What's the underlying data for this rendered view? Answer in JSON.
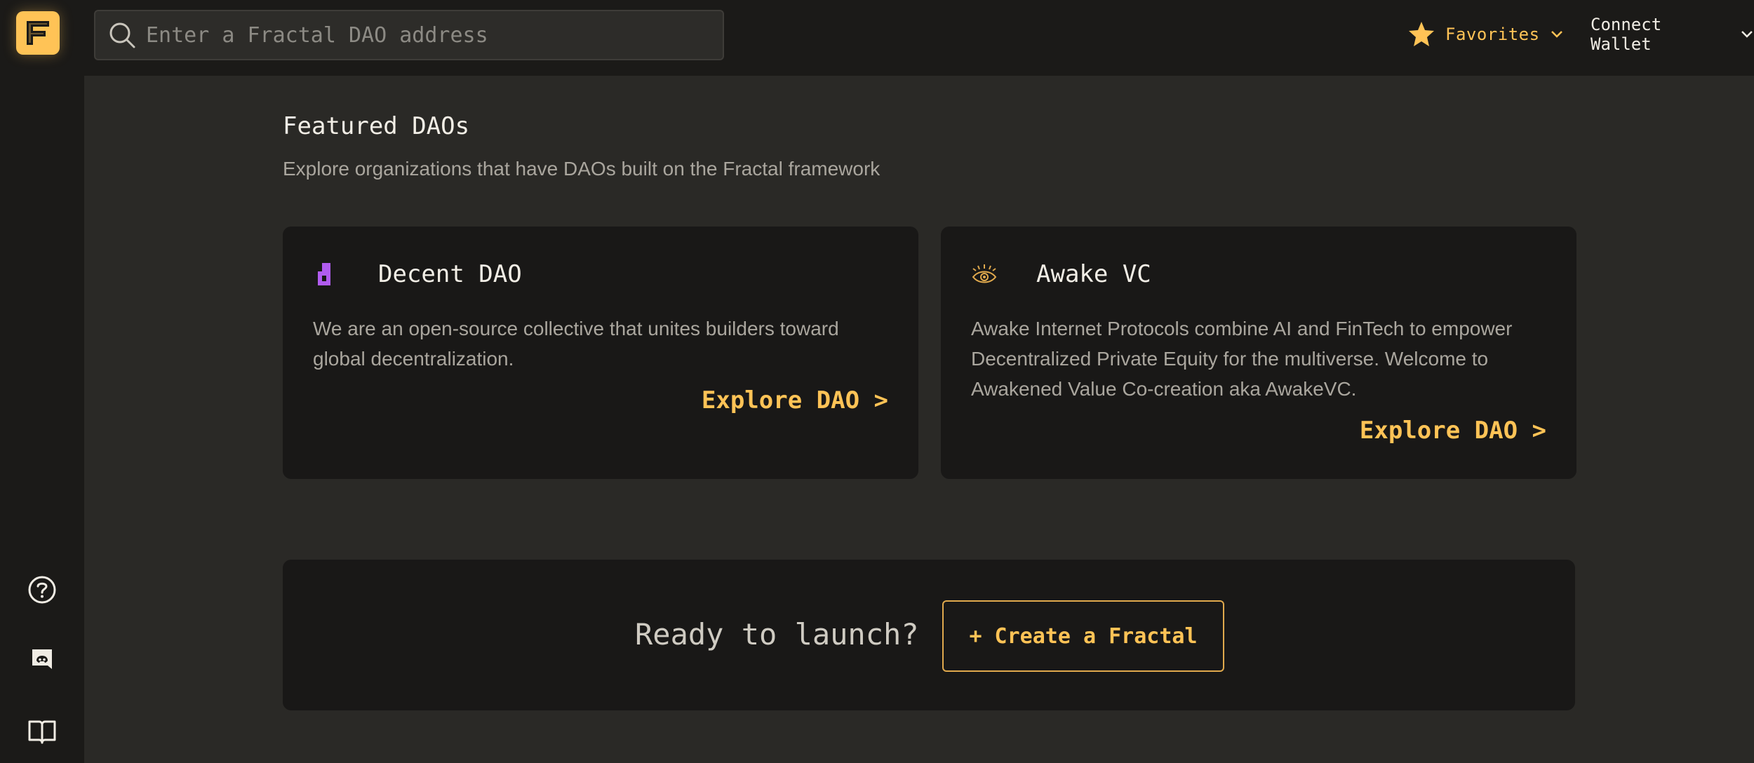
{
  "header": {
    "logo_letter": "F",
    "search_placeholder": "Enter a Fractal DAO address",
    "favorites_label": "Favorites",
    "connect_wallet_label": "Connect Wallet",
    "accent_color": "#ffc356"
  },
  "sidebar": {
    "items": [
      {
        "icon": "help-icon"
      },
      {
        "icon": "discord-icon"
      },
      {
        "icon": "docs-book-icon"
      }
    ]
  },
  "featured": {
    "title": "Featured DAOs",
    "subtitle": "Explore organizations that have DAOs built on the Fractal framework",
    "cards": [
      {
        "icon": "decent-dao-logo-icon",
        "title": "Decent DAO",
        "description": "We are an open-source collective that unites builders toward global decentralization.",
        "link": "Explore DAO >"
      },
      {
        "icon": "awake-eye-icon",
        "title": "Awake VC",
        "description": "Awake Internet Protocols combine AI and FinTech to empower Decentralized Private Equity for the multiverse. Welcome to Awakened Value Co-creation aka AwakeVC.",
        "link": "Explore DAO >"
      }
    ]
  },
  "launch": {
    "text": "Ready to launch?",
    "button_label": "+ Create a Fractal"
  }
}
